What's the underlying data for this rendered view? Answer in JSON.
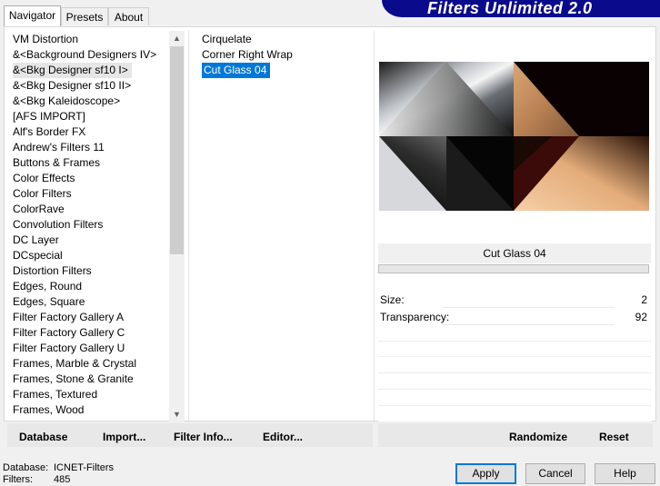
{
  "tabs": [
    "Navigator",
    "Presets",
    "About"
  ],
  "banner": {
    "title": "Filters Unlimited 2.0",
    "color": "#0a0a8c"
  },
  "categories": [
    "VM Distortion",
    "&<Background Designers IV>",
    "&<Bkg Designer sf10 I>",
    "&<Bkg Designer sf10 II>",
    "&<Bkg Kaleidoscope>",
    "[AFS IMPORT]",
    "Alf's Border FX",
    "Andrew's Filters 11",
    "Buttons & Frames",
    "Color Effects",
    "Color Filters",
    "ColorRave",
    "Convolution Filters",
    "DC Layer",
    "DCspecial",
    "Distortion Filters",
    "Edges, Round",
    "Edges, Square",
    "Filter Factory Gallery A",
    "Filter Factory Gallery C",
    "Filter Factory Gallery U",
    "Frames, Marble & Crystal",
    "Frames, Stone & Granite",
    "Frames, Textured",
    "Frames, Wood"
  ],
  "selected_category_index": 2,
  "filters": [
    "Cirquelate",
    "Corner Right Wrap",
    "Cut Glass 04"
  ],
  "selected_filter_index": 2,
  "filter_name": "Cut Glass 04",
  "params": [
    {
      "label": "Size:",
      "value": "2"
    },
    {
      "label": "Transparency:",
      "value": "92"
    }
  ],
  "left_links": {
    "database": "Database",
    "import": "Import...",
    "filter_info": "Filter Info...",
    "editor": "Editor..."
  },
  "right_links": {
    "randomize": "Randomize",
    "reset": "Reset"
  },
  "status": {
    "database_label": "Database:",
    "database_value": "ICNET-Filters",
    "filters_label": "Filters:",
    "filters_value": "485"
  },
  "buttons": {
    "apply": "Apply",
    "cancel": "Cancel",
    "help": "Help"
  },
  "colors": {
    "selection": "#0078d7",
    "accent_border": "#0078d7"
  }
}
